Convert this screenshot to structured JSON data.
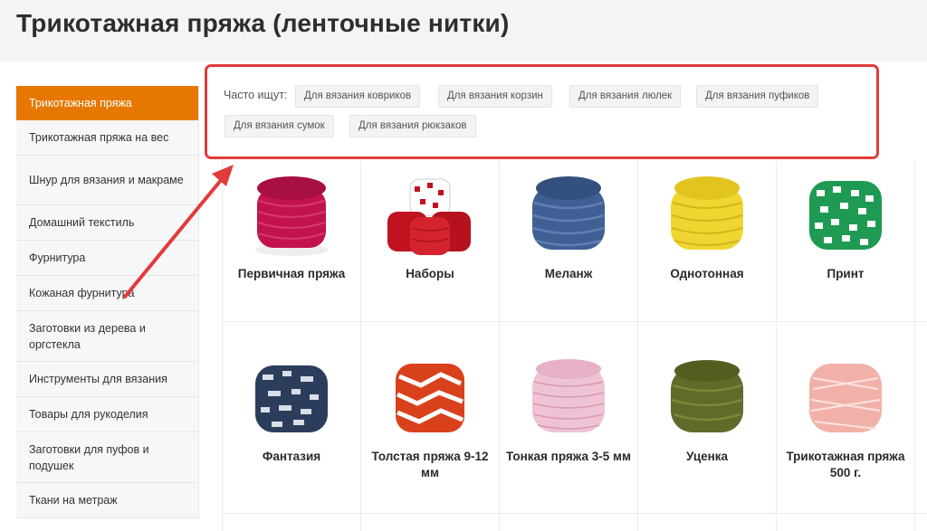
{
  "page": {
    "title": "Трикотажная пряжа (ленточные нитки)"
  },
  "sidebar": {
    "items": [
      {
        "label": "Трикотажная пряжа",
        "active": true
      },
      {
        "label": "Трикотажная пряжа на вес"
      },
      {
        "label": "Шнур для вязания и макраме"
      },
      {
        "label": "Домашний текстиль"
      },
      {
        "label": "Фурнитура"
      },
      {
        "label": "Кожаная фурнитура"
      },
      {
        "label": "Заготовки из дерева и оргстекла"
      },
      {
        "label": "Инструменты для вязания"
      },
      {
        "label": "Товары для рукоделия"
      },
      {
        "label": "Заготовки для пуфов и подушек"
      },
      {
        "label": "Ткани на метраж"
      }
    ]
  },
  "suggestions": {
    "label": "Часто ищут:",
    "tags": [
      "Для вязания ковриков",
      "Для вязания корзин",
      "Для вязания люлек",
      "Для вязания пуфиков",
      "Для вязания сумок",
      "Для вязания рюкзаков"
    ]
  },
  "products": [
    {
      "name": "Первичная пряжа",
      "icon": "yarn-ball-magenta",
      "color": "#c2134f"
    },
    {
      "name": "Наборы",
      "icon": "yarn-set-red-icon",
      "color": "#c0131f"
    },
    {
      "name": "Меланж",
      "icon": "yarn-ball-melange",
      "color": "#3f5f95"
    },
    {
      "name": "Однотонная",
      "icon": "yarn-ball-yellow",
      "color": "#f0d630"
    },
    {
      "name": "Принт",
      "icon": "yarn-ball-print",
      "color": "#1e9a52"
    },
    {
      "name": "Фантазия",
      "icon": "yarn-ball-fantasy",
      "color": "#2c3d5c"
    },
    {
      "name": "Толстая пряжа 9-12 мм",
      "icon": "yarn-ball-thick",
      "color": "#d9411c"
    },
    {
      "name": "Тонкая пряжа 3-5 мм",
      "icon": "yarn-ball-thin",
      "color": "#efc3d5"
    },
    {
      "name": "Уценка",
      "icon": "yarn-ball-olive",
      "color": "#5f6b28"
    },
    {
      "name": "Трикотажная пряжа 500 г.",
      "icon": "yarn-ball-peach",
      "color": "#f2b1a8"
    }
  ],
  "colors": {
    "accent": "#e67700",
    "highlight": "#e23b3b"
  }
}
